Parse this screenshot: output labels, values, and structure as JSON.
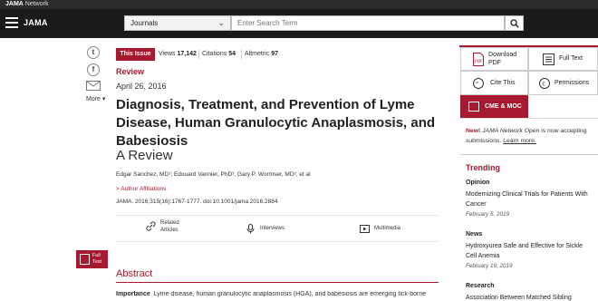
{
  "network_bar": {
    "brand_bold": "JAMA",
    "brand_rest": " Network"
  },
  "header": {
    "logo": "JAMA",
    "journal_select": "Journals",
    "search_placeholder": "Enter Search Term"
  },
  "share": {
    "twitter_glyph": "t",
    "facebook_glyph": "f",
    "more_label": "More ▾"
  },
  "article": {
    "this_issue": "This Issue",
    "views_label": "Views",
    "views_value": "17,142",
    "citations_label": "Citations",
    "citations_value": "54",
    "altmetric_label": "Altmetric",
    "altmetric_value": "97",
    "kicker": "Review",
    "date": "April 26, 2016",
    "title": "Diagnosis, Treatment, and Prevention of Lyme Disease, Human Granulocytic Anaplasmosis, and Babesiosis",
    "subtitle": "A Review",
    "authors": "Edgar Sanchez, MD¹; Edouard Vannier, PhD¹; Gary P. Wormser, MD²; et al",
    "affiliations": "> Author Affiliations",
    "citation": "JAMA. 2016;315(16):1767-1777. doi:10.1001/jama.2016.2884",
    "tools": {
      "related": "Related\nArticles",
      "interviews": "Interviews",
      "multimedia": "Multimedia"
    },
    "full_text_tab": "Full\nText",
    "abstract_heading": "Abstract",
    "abstract_label": "Importance",
    "abstract_text": "Lyme disease, human granulocytic anaplasmosis (HGA), and babesiosis are emerging tick-borne"
  },
  "sidebar": {
    "download_pdf": "Download\nPDF",
    "full_text": "Full Text",
    "cite_this": "Cite This",
    "permissions": "Permissions",
    "cme": "CME & MOC",
    "news_new": "New!",
    "news_journal": "JAMA Network Open",
    "news_text": " is now accepting submissions.",
    "news_link": "Learn more.",
    "trending_heading": "Trending",
    "trending": [
      {
        "type": "Opinion",
        "title": "Modernizing Clinical Trials for Patients With Cancer",
        "date": "February 5, 2019"
      },
      {
        "type": "News",
        "title": "Hydroxyurea Safe and Effective for Sickle Cell Anemia",
        "date": "February 19, 2019"
      },
      {
        "type": "Research",
        "title": "Association Between Matched Sibling",
        "date": ""
      }
    ]
  },
  "colors": {
    "accent": "#a6192e",
    "header_bg": "#1a1a1a"
  }
}
